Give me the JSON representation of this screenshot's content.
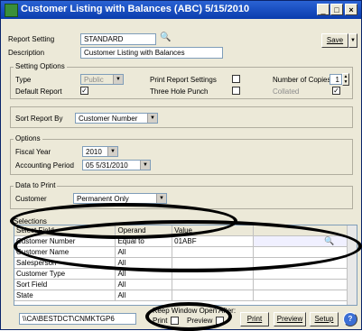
{
  "window": {
    "title": "Customer Listing with Balances (ABC) 5/15/2010",
    "minimize": "_",
    "maximize": "□",
    "close": "×"
  },
  "report": {
    "setting_label": "Report Setting",
    "setting_value": "STANDARD",
    "description_label": "Description",
    "description_value": "Customer Listing with Balances",
    "save_label": "Save"
  },
  "setting_options": {
    "group_label": "Setting Options",
    "type_label": "Type",
    "type_value": "Public",
    "default_report_label": "Default Report",
    "print_report_settings_label": "Print Report Settings",
    "three_hole_punch_label": "Three Hole Punch",
    "number_of_copies_label": "Number of Copies",
    "number_of_copies_value": "1",
    "collated_label": "Collated"
  },
  "sort": {
    "label": "Sort Report By",
    "value": "Customer Number"
  },
  "options": {
    "group_label": "Options",
    "fiscal_year_label": "Fiscal Year",
    "fiscal_year_value": "2010",
    "accounting_period_label": "Accounting Period",
    "accounting_period_value": "05 5/31/2010"
  },
  "data_to_print": {
    "group_label": "Data to Print",
    "customer_label": "Customer",
    "value": "Permanent Only"
  },
  "selections": {
    "group_label": "Selections",
    "columns": [
      "Select Field",
      "Operand",
      "Value",
      ""
    ],
    "rows": [
      {
        "field": "Customer Number",
        "operand": "Equal to",
        "value": "01ABF"
      },
      {
        "field": "Customer Name",
        "operand": "All",
        "value": ""
      },
      {
        "field": "Salesperson",
        "operand": "All",
        "value": ""
      },
      {
        "field": "Customer Type",
        "operand": "All",
        "value": ""
      },
      {
        "field": "Sort Field",
        "operand": "All",
        "value": ""
      },
      {
        "field": "State",
        "operand": "All",
        "value": ""
      }
    ]
  },
  "footer": {
    "path": "\\\\CA\\BESTDCT\\CNMKTGP6",
    "keep_window_label": "Keep Window Open After:",
    "print_check_label": "Print",
    "preview_check_label": "Preview",
    "print_button": "Print",
    "preview_button": "Preview",
    "setup_button": "Setup",
    "help_button": "?"
  },
  "colors": {
    "titlebar": "#0a3cad",
    "window_bg": "#ece9d8",
    "annotation": "#000000"
  }
}
